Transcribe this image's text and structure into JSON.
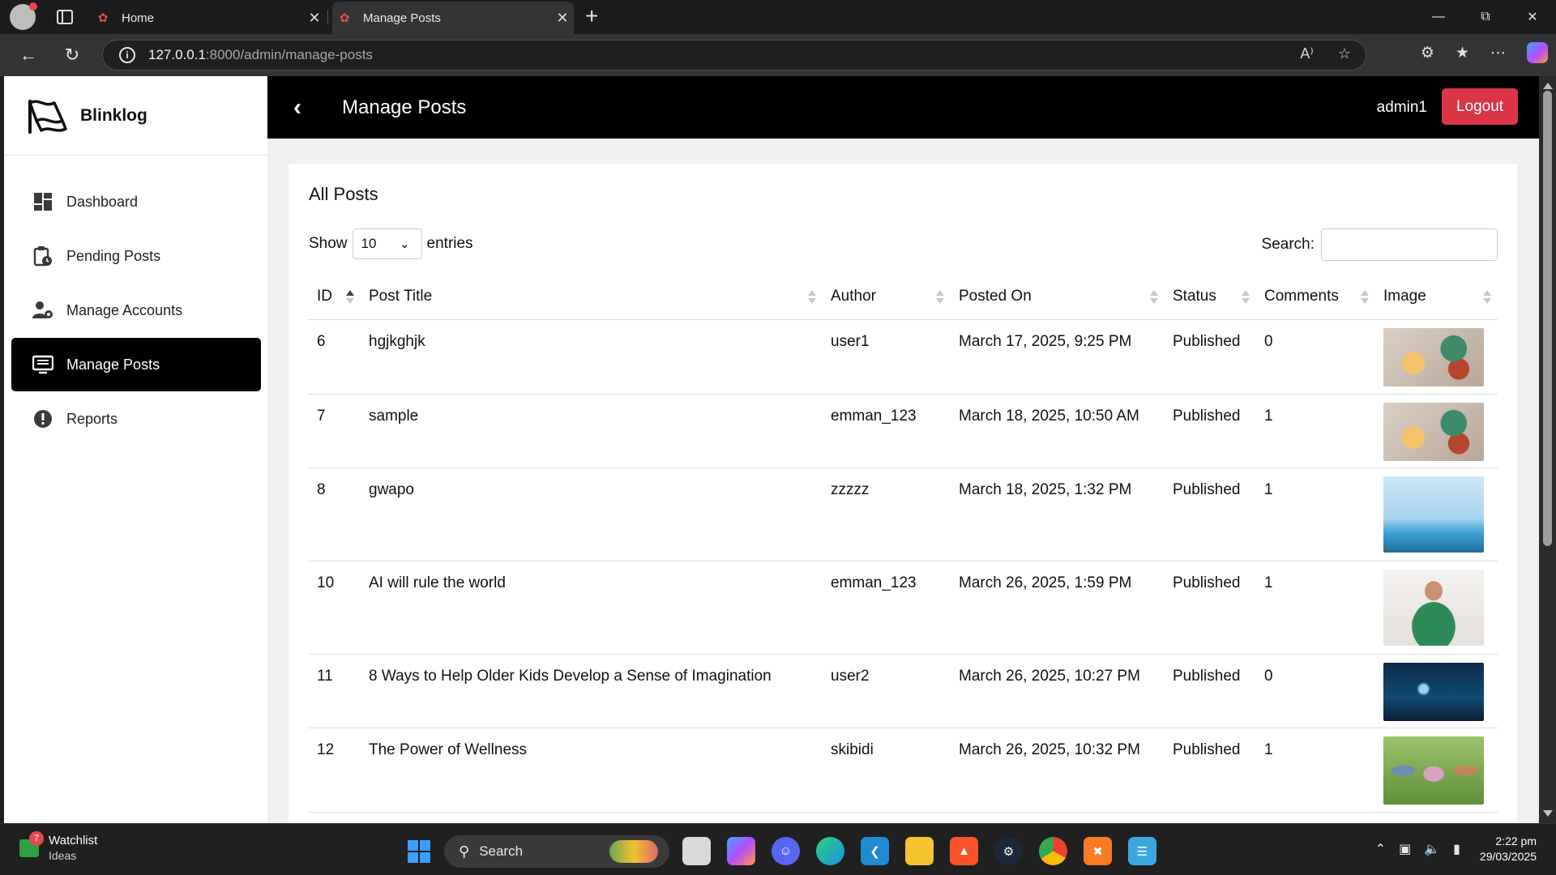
{
  "browser": {
    "tabs": [
      {
        "title": "Home",
        "active": false
      },
      {
        "title": "Manage Posts",
        "active": true
      }
    ],
    "url_host": "127.0.0.1",
    "url_path": ":8000/admin/manage-posts"
  },
  "sidebar": {
    "brand": "Blinklog",
    "items": [
      {
        "label": "Dashboard",
        "icon": "dashboard-icon",
        "active": false
      },
      {
        "label": "Pending Posts",
        "icon": "clipboard-clock-icon",
        "active": false
      },
      {
        "label": "Manage Accounts",
        "icon": "user-gear-icon",
        "active": false
      },
      {
        "label": "Manage Posts",
        "icon": "monitor-list-icon",
        "active": true
      },
      {
        "label": "Reports",
        "icon": "exclamation-circle-icon",
        "active": false
      }
    ]
  },
  "topbar": {
    "title": "Manage Posts",
    "username": "admin1",
    "logout_label": "Logout"
  },
  "card": {
    "title": "All Posts",
    "show_label": "Show",
    "entries_label": "entries",
    "page_length": "10",
    "search_label": "Search:",
    "search_value": ""
  },
  "table": {
    "columns": [
      "ID",
      "Post Title",
      "Author",
      "Posted On",
      "Status",
      "Comments",
      "Image"
    ],
    "rows": [
      {
        "id": "6",
        "title": "hgjkghjk",
        "author": "user1",
        "posted": "March 17, 2025, 9:25 PM",
        "status": "Published",
        "comments": "0",
        "image": "food-photo"
      },
      {
        "id": "7",
        "title": "sample",
        "author": "emman_123",
        "posted": "March 18, 2025, 10:50 AM",
        "status": "Published",
        "comments": "1",
        "image": "food-photo"
      },
      {
        "id": "8",
        "title": "gwapo",
        "author": "zzzzz",
        "posted": "March 18, 2025, 1:32 PM",
        "status": "Published",
        "comments": "1",
        "image": "travel-landmarks-photo"
      },
      {
        "id": "10",
        "title": "AI will rule the world",
        "author": "emman_123",
        "posted": "March 26, 2025, 1:59 PM",
        "status": "Published",
        "comments": "1",
        "image": "woman-portrait-photo"
      },
      {
        "id": "11",
        "title": "8 Ways to Help Older Kids Develop a Sense of Imagination",
        "author": "user2",
        "posted": "March 26, 2025, 10:27 PM",
        "status": "Published",
        "comments": "0",
        "image": "night-sea-photo"
      },
      {
        "id": "12",
        "title": "The Power of Wellness",
        "author": "skibidi",
        "posted": "March 26, 2025, 10:32 PM",
        "status": "Published",
        "comments": "1",
        "image": "outdoor-exercise-photo"
      }
    ]
  },
  "taskbar": {
    "widget_title": "Watchlist",
    "widget_sub": "Ideas",
    "widget_badge": "7",
    "search_label": "Search",
    "time": "2:22 pm",
    "date": "29/03/2025"
  },
  "colors": {
    "accent_black": "#000000",
    "logout_red": "#dc3545",
    "page_bg": "#f0f0f0"
  }
}
